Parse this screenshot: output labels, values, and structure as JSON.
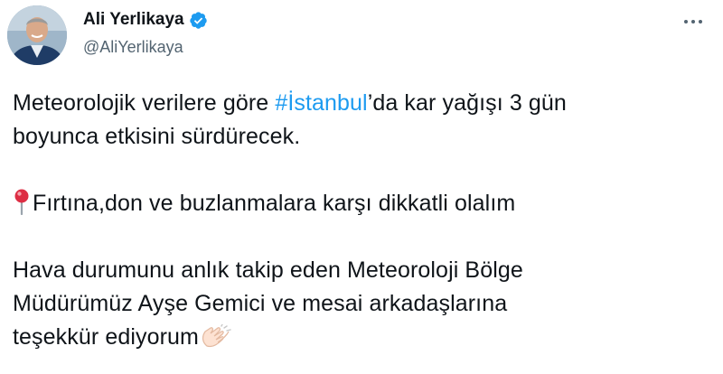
{
  "author": {
    "display_name": "Ali Yerlikaya",
    "handle": "@AliYerlikaya",
    "verified": true
  },
  "colors": {
    "link": "#1d9bf0",
    "text": "#0f1419",
    "secondary": "#536471",
    "verified": "#1d9bf0"
  },
  "tweet": {
    "line1_pre": "Meteorolojik verilere göre ",
    "hashtag": "#İstanbul",
    "line1_post": "’da kar yağışı 3 gün",
    "line2": "boyunca etkisini sürdürecek.",
    "line3": "Fırtına,don ve buzlanmalara karşı dikkatli olalım",
    "line4": "Hava durumunu anlık takip eden Meteoroloji Bölge",
    "line5": "Müdürümüz Ayşe Gemici ve mesai arkadaşlarına",
    "line6": "teşekkür ediyorum"
  },
  "icons": {
    "verified": "verified-badge-icon",
    "more": "more-options-icon",
    "pin": "round-pushpin-icon",
    "clap": "clapping-hands-icon"
  }
}
